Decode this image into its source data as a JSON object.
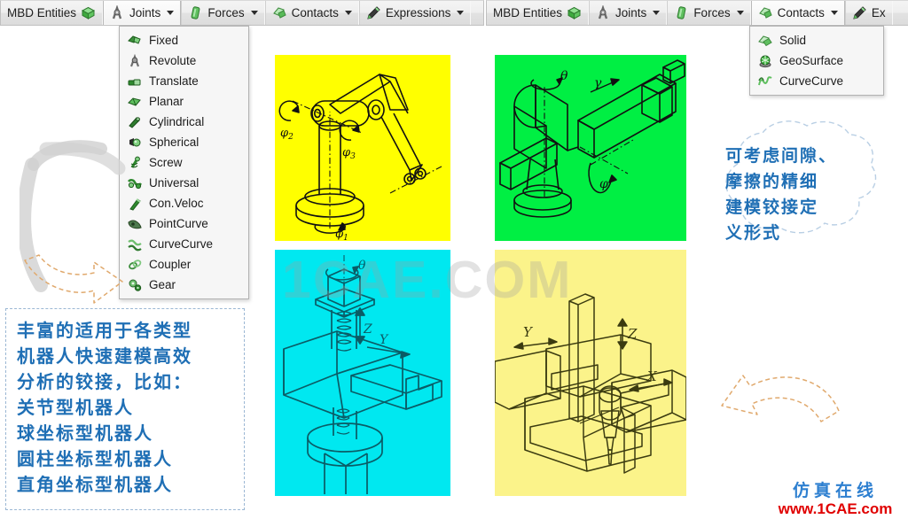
{
  "toolbars": {
    "left": {
      "items": [
        {
          "label": "MBD Entities",
          "icon": "green-box-icon",
          "caret": false,
          "open": false
        },
        {
          "label": "Joints",
          "icon": "joint-icon",
          "caret": true,
          "open": true
        },
        {
          "label": "Forces",
          "icon": "force-icon",
          "caret": true,
          "open": false
        },
        {
          "label": "Contacts",
          "icon": "contact-icon",
          "caret": true,
          "open": false
        },
        {
          "label": "Expressions",
          "icon": "expression-icon",
          "caret": true,
          "open": false
        }
      ]
    },
    "right": {
      "items": [
        {
          "label": "MBD Entities",
          "icon": "green-box-icon",
          "caret": false,
          "open": false
        },
        {
          "label": "Joints",
          "icon": "joint-icon",
          "caret": true,
          "open": false
        },
        {
          "label": "Forces",
          "icon": "force-icon",
          "caret": true,
          "open": false
        },
        {
          "label": "Contacts",
          "icon": "contact-icon",
          "caret": true,
          "open": true
        },
        {
          "label": "Ex",
          "icon": "expression-icon",
          "caret": false,
          "open": false
        }
      ]
    }
  },
  "menus": {
    "joints": {
      "items": [
        {
          "label": "Fixed",
          "icon": "fixed-joint-icon"
        },
        {
          "label": "Revolute",
          "icon": "revolute-joint-icon"
        },
        {
          "label": "Translate",
          "icon": "translate-joint-icon"
        },
        {
          "label": "Planar",
          "icon": "planar-joint-icon"
        },
        {
          "label": "Cylindrical",
          "icon": "cylindrical-joint-icon"
        },
        {
          "label": "Spherical",
          "icon": "spherical-joint-icon"
        },
        {
          "label": "Screw",
          "icon": "screw-joint-icon"
        },
        {
          "label": "Universal",
          "icon": "universal-joint-icon"
        },
        {
          "label": "Con.Veloc",
          "icon": "constant-velocity-joint-icon"
        },
        {
          "label": "PointCurve",
          "icon": "point-curve-icon"
        },
        {
          "label": "CurveCurve",
          "icon": "curve-curve-icon"
        },
        {
          "label": "Coupler",
          "icon": "coupler-icon"
        },
        {
          "label": "Gear",
          "icon": "gear-joint-icon"
        }
      ]
    },
    "contacts": {
      "items": [
        {
          "label": "Solid",
          "icon": "solid-contact-icon"
        },
        {
          "label": "GeoSurface",
          "icon": "geosurface-contact-icon"
        },
        {
          "label": "CurveCurve",
          "icon": "curvecurve-contact-icon"
        }
      ]
    }
  },
  "panels": {
    "top_left": {
      "name": "articulated-robot",
      "bg": "#ffff00",
      "labels": [
        "φ₁",
        "φ₂",
        "φ₃"
      ]
    },
    "top_right": {
      "name": "spherical-robot",
      "bg": "#00ef43",
      "labels": [
        "θ",
        "γ",
        "φ"
      ]
    },
    "bottom_left": {
      "name": "cylindrical-robot",
      "bg": "#00e8f0",
      "labels": [
        "θ",
        "Z",
        "Y"
      ]
    },
    "bottom_right": {
      "name": "cartesian-gantry-robot",
      "bg": "#fbf38a",
      "labels": [
        "X",
        "Y",
        "Z"
      ]
    }
  },
  "watermark": {
    "text": "1CAE.COM"
  },
  "note_box": {
    "lines": [
      "丰富的适用于各类型",
      "机器人快速建模高效",
      "分析的铰接，比如：",
      "关节型机器人",
      "球坐标型机器人",
      "圆柱坐标型机器人",
      "直角坐标型机器人"
    ]
  },
  "cloud": {
    "lines": [
      "可考虑间隙、",
      "摩擦的精细",
      "建模铰接定",
      "义形式"
    ]
  },
  "sitemark": {
    "cn": "仿真在线",
    "url": "www.1CAE.com"
  },
  "colors": {
    "accent_blue": "#1f6fb5",
    "site_red": "#e00000",
    "arrow_outline": "#e0a96d",
    "arrow_fill": "#d6d6d6",
    "panel_yellow": "#ffff00",
    "panel_green": "#00ef43",
    "panel_cyan": "#00e8f0",
    "panel_lightyellow": "#fbf38a"
  }
}
